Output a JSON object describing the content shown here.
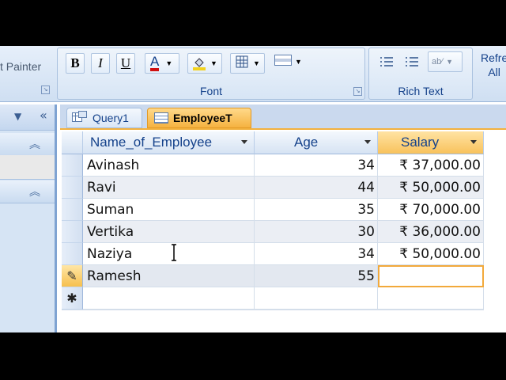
{
  "ribbon": {
    "clipboard_partial": "t Painter",
    "font_group_label": "Font",
    "rich_text_group_label": "Rich Text",
    "refresh_partial": "Refre\nAll",
    "bold": "B",
    "italic": "I",
    "underline": "U",
    "font_color_letter": "A",
    "font_color": "#d01010"
  },
  "tabs": [
    {
      "label": "Query1"
    },
    {
      "label": "EmployeeT"
    }
  ],
  "columns": [
    "Name_of_Employee",
    "Age",
    "Salary"
  ],
  "rows": [
    {
      "name": "Avinash",
      "age": "34",
      "salary": "₹ 37,000.00"
    },
    {
      "name": "Ravi",
      "age": "44",
      "salary": "₹ 50,000.00"
    },
    {
      "name": "Suman",
      "age": "35",
      "salary": "₹ 70,000.00"
    },
    {
      "name": "Vertika",
      "age": "30",
      "salary": "₹ 36,000.00"
    },
    {
      "name": "Naziya",
      "age": "34",
      "salary": "₹ 50,000.00"
    },
    {
      "name": "Ramesh",
      "age": "55",
      "salary": ""
    }
  ],
  "new_record_marker": "✱",
  "editing_marker": "✎",
  "accent_color": "#f2a93b"
}
